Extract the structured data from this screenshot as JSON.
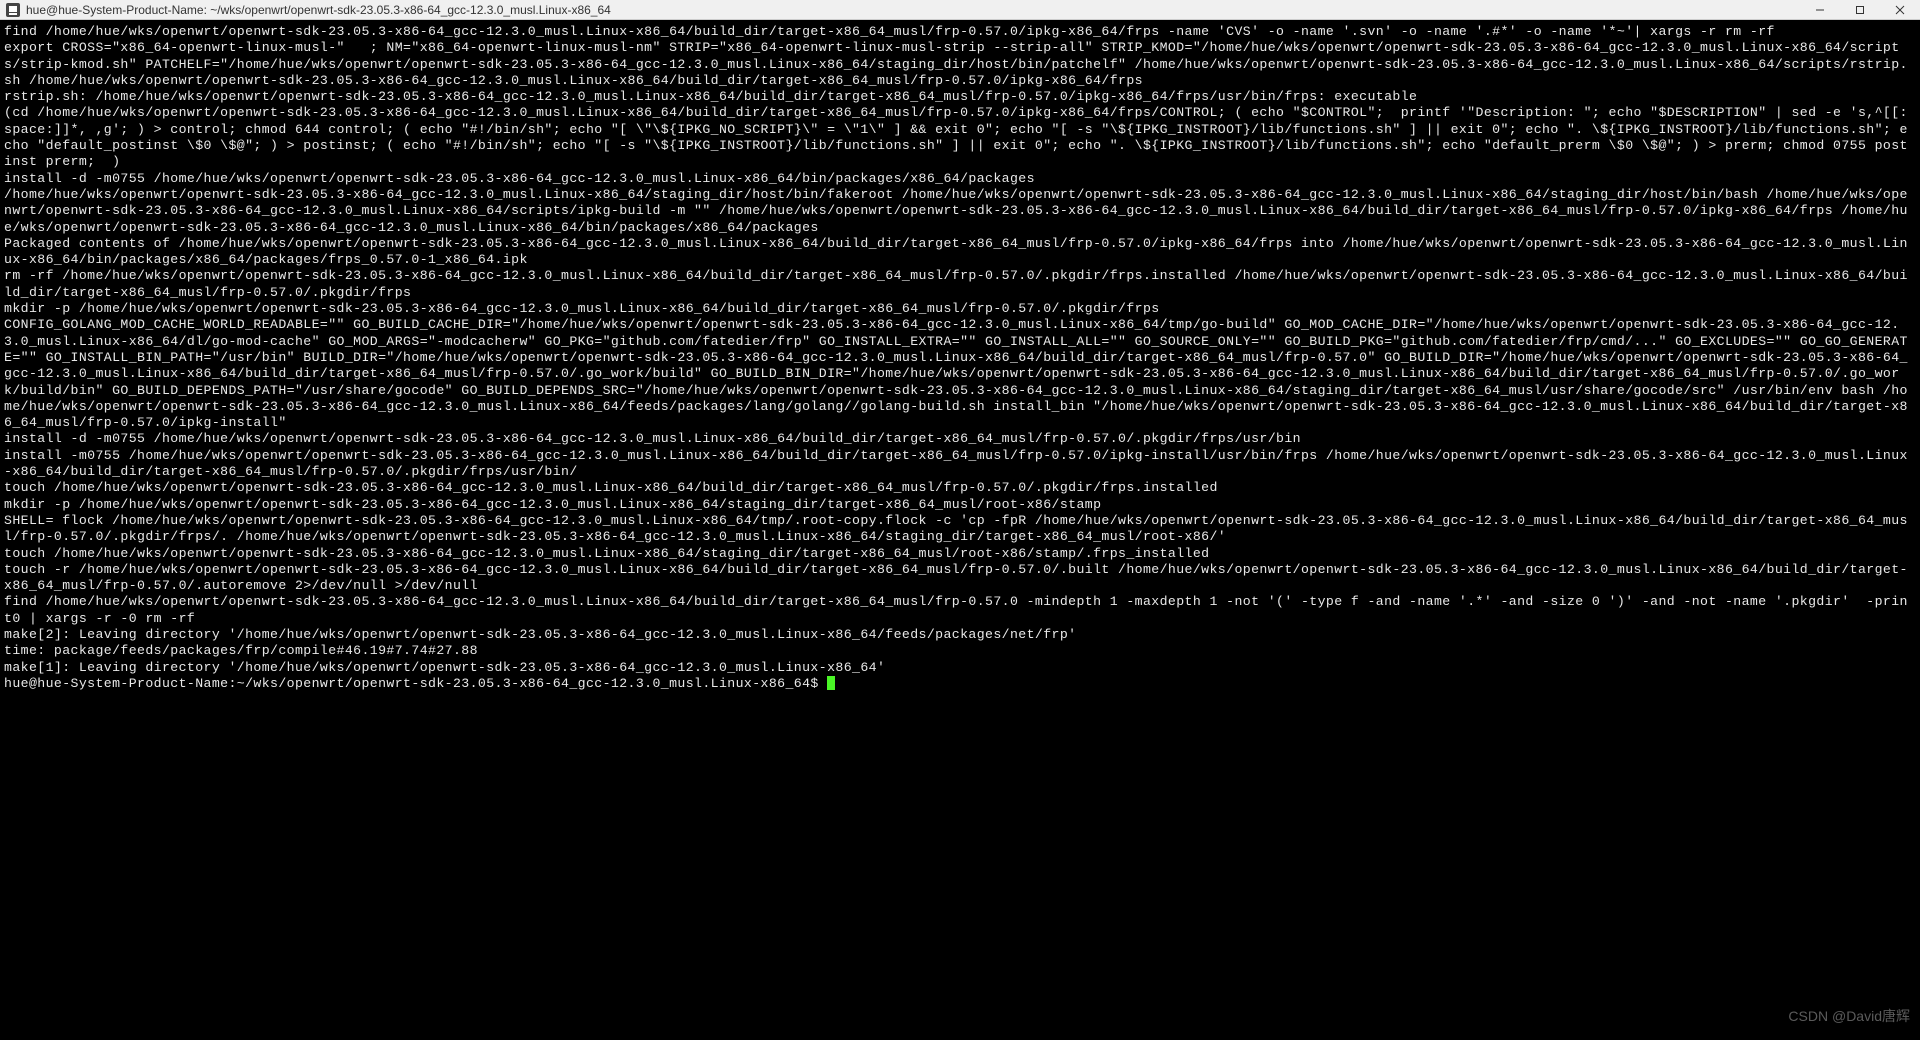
{
  "window": {
    "title": "hue@hue-System-Product-Name: ~/wks/openwrt/openwrt-sdk-23.05.3-x86-64_gcc-12.3.0_musl.Linux-x86_64"
  },
  "terminal": {
    "lines": [
      "find /home/hue/wks/openwrt/openwrt-sdk-23.05.3-x86-64_gcc-12.3.0_musl.Linux-x86_64/build_dir/target-x86_64_musl/frp-0.57.0/ipkg-x86_64/frps -name 'CVS' -o -name '.svn' -o -name '.#*' -o -name '*~'| xargs -r rm -rf",
      "export CROSS=\"x86_64-openwrt-linux-musl-\"   ; NM=\"x86_64-openwrt-linux-musl-nm\" STRIP=\"x86_64-openwrt-linux-musl-strip --strip-all\" STRIP_KMOD=\"/home/hue/wks/openwrt/openwrt-sdk-23.05.3-x86-64_gcc-12.3.0_musl.Linux-x86_64/scripts/strip-kmod.sh\" PATCHELF=\"/home/hue/wks/openwrt/openwrt-sdk-23.05.3-x86-64_gcc-12.3.0_musl.Linux-x86_64/staging_dir/host/bin/patchelf\" /home/hue/wks/openwrt/openwrt-sdk-23.05.3-x86-64_gcc-12.3.0_musl.Linux-x86_64/scripts/rstrip.sh /home/hue/wks/openwrt/openwrt-sdk-23.05.3-x86-64_gcc-12.3.0_musl.Linux-x86_64/build_dir/target-x86_64_musl/frp-0.57.0/ipkg-x86_64/frps",
      "rstrip.sh: /home/hue/wks/openwrt/openwrt-sdk-23.05.3-x86-64_gcc-12.3.0_musl.Linux-x86_64/build_dir/target-x86_64_musl/frp-0.57.0/ipkg-x86_64/frps/usr/bin/frps: executable",
      "(cd /home/hue/wks/openwrt/openwrt-sdk-23.05.3-x86-64_gcc-12.3.0_musl.Linux-x86_64/build_dir/target-x86_64_musl/frp-0.57.0/ipkg-x86_64/frps/CONTROL; ( echo \"$CONTROL\";  printf '\"Description: \"; echo \"$DESCRIPTION\" | sed -e 's,^[[:space:]]*, ,g'; ) > control; chmod 644 control; ( echo \"#!/bin/sh\"; echo \"[ \\\"\\${IPKG_NO_SCRIPT}\\\" = \\\"1\\\" ] && exit 0\"; echo \"[ -s \"\\${IPKG_INSTROOT}/lib/functions.sh\" ] || exit 0\"; echo \". \\${IPKG_INSTROOT}/lib/functions.sh\"; echo \"default_postinst \\$0 \\$@\"; ) > postinst; ( echo \"#!/bin/sh\"; echo \"[ -s \"\\${IPKG_INSTROOT}/lib/functions.sh\" ] || exit 0\"; echo \". \\${IPKG_INSTROOT}/lib/functions.sh\"; echo \"default_prerm \\$0 \\$@\"; ) > prerm; chmod 0755 postinst prerm;  )",
      "install -d -m0755 /home/hue/wks/openwrt/openwrt-sdk-23.05.3-x86-64_gcc-12.3.0_musl.Linux-x86_64/bin/packages/x86_64/packages",
      "/home/hue/wks/openwrt/openwrt-sdk-23.05.3-x86-64_gcc-12.3.0_musl.Linux-x86_64/staging_dir/host/bin/fakeroot /home/hue/wks/openwrt/openwrt-sdk-23.05.3-x86-64_gcc-12.3.0_musl.Linux-x86_64/staging_dir/host/bin/bash /home/hue/wks/openwrt/openwrt-sdk-23.05.3-x86-64_gcc-12.3.0_musl.Linux-x86_64/scripts/ipkg-build -m \"\" /home/hue/wks/openwrt/openwrt-sdk-23.05.3-x86-64_gcc-12.3.0_musl.Linux-x86_64/build_dir/target-x86_64_musl/frp-0.57.0/ipkg-x86_64/frps /home/hue/wks/openwrt/openwrt-sdk-23.05.3-x86-64_gcc-12.3.0_musl.Linux-x86_64/bin/packages/x86_64/packages",
      "Packaged contents of /home/hue/wks/openwrt/openwrt-sdk-23.05.3-x86-64_gcc-12.3.0_musl.Linux-x86_64/build_dir/target-x86_64_musl/frp-0.57.0/ipkg-x86_64/frps into /home/hue/wks/openwrt/openwrt-sdk-23.05.3-x86-64_gcc-12.3.0_musl.Linux-x86_64/bin/packages/x86_64/packages/frps_0.57.0-1_x86_64.ipk",
      "rm -rf /home/hue/wks/openwrt/openwrt-sdk-23.05.3-x86-64_gcc-12.3.0_musl.Linux-x86_64/build_dir/target-x86_64_musl/frp-0.57.0/.pkgdir/frps.installed /home/hue/wks/openwrt/openwrt-sdk-23.05.3-x86-64_gcc-12.3.0_musl.Linux-x86_64/build_dir/target-x86_64_musl/frp-0.57.0/.pkgdir/frps",
      "mkdir -p /home/hue/wks/openwrt/openwrt-sdk-23.05.3-x86-64_gcc-12.3.0_musl.Linux-x86_64/build_dir/target-x86_64_musl/frp-0.57.0/.pkgdir/frps",
      "CONFIG_GOLANG_MOD_CACHE_WORLD_READABLE=\"\" GO_BUILD_CACHE_DIR=\"/home/hue/wks/openwrt/openwrt-sdk-23.05.3-x86-64_gcc-12.3.0_musl.Linux-x86_64/tmp/go-build\" GO_MOD_CACHE_DIR=\"/home/hue/wks/openwrt/openwrt-sdk-23.05.3-x86-64_gcc-12.3.0_musl.Linux-x86_64/dl/go-mod-cache\" GO_MOD_ARGS=\"-modcacherw\" GO_PKG=\"github.com/fatedier/frp\" GO_INSTALL_EXTRA=\"\" GO_INSTALL_ALL=\"\" GO_SOURCE_ONLY=\"\" GO_BUILD_PKG=\"github.com/fatedier/frp/cmd/...\" GO_EXCLUDES=\"\" GO_GO_GENERATE=\"\" GO_INSTALL_BIN_PATH=\"/usr/bin\" BUILD_DIR=\"/home/hue/wks/openwrt/openwrt-sdk-23.05.3-x86-64_gcc-12.3.0_musl.Linux-x86_64/build_dir/target-x86_64_musl/frp-0.57.0\" GO_BUILD_DIR=\"/home/hue/wks/openwrt/openwrt-sdk-23.05.3-x86-64_gcc-12.3.0_musl.Linux-x86_64/build_dir/target-x86_64_musl/frp-0.57.0/.go_work/build\" GO_BUILD_BIN_DIR=\"/home/hue/wks/openwrt/openwrt-sdk-23.05.3-x86-64_gcc-12.3.0_musl.Linux-x86_64/build_dir/target-x86_64_musl/frp-0.57.0/.go_work/build/bin\" GO_BUILD_DEPENDS_PATH=\"/usr/share/gocode\" GO_BUILD_DEPENDS_SRC=\"/home/hue/wks/openwrt/openwrt-sdk-23.05.3-x86-64_gcc-12.3.0_musl.Linux-x86_64/staging_dir/target-x86_64_musl/usr/share/gocode/src\" /usr/bin/env bash /home/hue/wks/openwrt/openwrt-sdk-23.05.3-x86-64_gcc-12.3.0_musl.Linux-x86_64/feeds/packages/lang/golang//golang-build.sh install_bin \"/home/hue/wks/openwrt/openwrt-sdk-23.05.3-x86-64_gcc-12.3.0_musl.Linux-x86_64/build_dir/target-x86_64_musl/frp-0.57.0/ipkg-install\"",
      "install -d -m0755 /home/hue/wks/openwrt/openwrt-sdk-23.05.3-x86-64_gcc-12.3.0_musl.Linux-x86_64/build_dir/target-x86_64_musl/frp-0.57.0/.pkgdir/frps/usr/bin",
      "install -m0755 /home/hue/wks/openwrt/openwrt-sdk-23.05.3-x86-64_gcc-12.3.0_musl.Linux-x86_64/build_dir/target-x86_64_musl/frp-0.57.0/ipkg-install/usr/bin/frps /home/hue/wks/openwrt/openwrt-sdk-23.05.3-x86-64_gcc-12.3.0_musl.Linux-x86_64/build_dir/target-x86_64_musl/frp-0.57.0/.pkgdir/frps/usr/bin/",
      "touch /home/hue/wks/openwrt/openwrt-sdk-23.05.3-x86-64_gcc-12.3.0_musl.Linux-x86_64/build_dir/target-x86_64_musl/frp-0.57.0/.pkgdir/frps.installed",
      "mkdir -p /home/hue/wks/openwrt/openwrt-sdk-23.05.3-x86-64_gcc-12.3.0_musl.Linux-x86_64/staging_dir/target-x86_64_musl/root-x86/stamp",
      "SHELL= flock /home/hue/wks/openwrt/openwrt-sdk-23.05.3-x86-64_gcc-12.3.0_musl.Linux-x86_64/tmp/.root-copy.flock -c 'cp -fpR /home/hue/wks/openwrt/openwrt-sdk-23.05.3-x86-64_gcc-12.3.0_musl.Linux-x86_64/build_dir/target-x86_64_musl/frp-0.57.0/.pkgdir/frps/. /home/hue/wks/openwrt/openwrt-sdk-23.05.3-x86-64_gcc-12.3.0_musl.Linux-x86_64/staging_dir/target-x86_64_musl/root-x86/'",
      "touch /home/hue/wks/openwrt/openwrt-sdk-23.05.3-x86-64_gcc-12.3.0_musl.Linux-x86_64/staging_dir/target-x86_64_musl/root-x86/stamp/.frps_installed",
      "touch -r /home/hue/wks/openwrt/openwrt-sdk-23.05.3-x86-64_gcc-12.3.0_musl.Linux-x86_64/build_dir/target-x86_64_musl/frp-0.57.0/.built /home/hue/wks/openwrt/openwrt-sdk-23.05.3-x86-64_gcc-12.3.0_musl.Linux-x86_64/build_dir/target-x86_64_musl/frp-0.57.0/.autoremove 2>/dev/null >/dev/null",
      "find /home/hue/wks/openwrt/openwrt-sdk-23.05.3-x86-64_gcc-12.3.0_musl.Linux-x86_64/build_dir/target-x86_64_musl/frp-0.57.0 -mindepth 1 -maxdepth 1 -not '(' -type f -and -name '.*' -and -size 0 ')' -and -not -name '.pkgdir'  -print0 | xargs -r -0 rm -rf",
      "make[2]: Leaving directory '/home/hue/wks/openwrt/openwrt-sdk-23.05.3-x86-64_gcc-12.3.0_musl.Linux-x86_64/feeds/packages/net/frp'",
      "time: package/feeds/packages/frp/compile#46.19#7.74#27.88",
      "make[1]: Leaving directory '/home/hue/wks/openwrt/openwrt-sdk-23.05.3-x86-64_gcc-12.3.0_musl.Linux-x86_64'"
    ],
    "prompt": "hue@hue-System-Product-Name:~/wks/openwrt/openwrt-sdk-23.05.3-x86-64_gcc-12.3.0_musl.Linux-x86_64$ "
  },
  "watermark": "CSDN @David唐辉"
}
